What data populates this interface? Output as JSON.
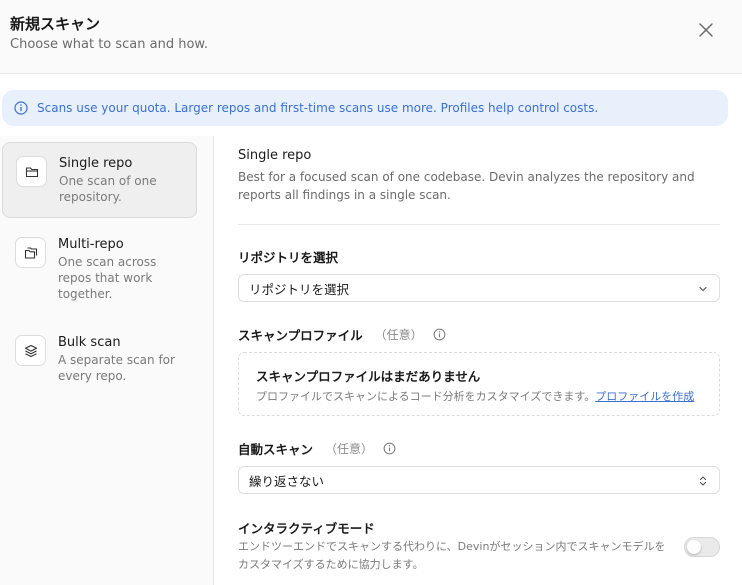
{
  "dialog": {
    "title": "新規スキャン",
    "subtitle": "Choose what to scan and how."
  },
  "banner": {
    "text": "Scans use your quota. Larger repos and first-time scans use more. Profiles help control costs.",
    "color": "#3a6fd8"
  },
  "scan_types": [
    {
      "title": "Single repo",
      "description": "One scan of one repository.",
      "icon": "folder-icon",
      "selected": true
    },
    {
      "title": "Multi-repo",
      "description": "One scan across repos that work together.",
      "icon": "folders-icon",
      "selected": false
    },
    {
      "title": "Bulk scan",
      "description": "A separate scan for every repo.",
      "icon": "layers-icon",
      "selected": false
    }
  ],
  "details": {
    "title": "Single repo",
    "description": "Best for a focused scan of one codebase. Devin analyzes the repository and reports all findings in a single scan."
  },
  "repository": {
    "label": "リポジトリを選択",
    "value": "リポジトリを選択"
  },
  "profile": {
    "label": "スキャンプロファイル",
    "optional": "（任意）",
    "empty_title": "スキャンプロファイルはまだありません",
    "empty_desc": "プロファイルでスキャンによるコード分析をカスタマイズできます。",
    "create_link": "プロファイルを作成"
  },
  "auto_scan": {
    "label": "自動スキャン",
    "optional": "（任意）",
    "value": "繰り返さない"
  },
  "interactive_mode": {
    "label": "インタラクティブモード",
    "description": "エンドツーエンドでスキャンする代わりに、Devinがセッション内でスキャンモデルをカスタマイズするために協力します。",
    "enabled": false
  }
}
